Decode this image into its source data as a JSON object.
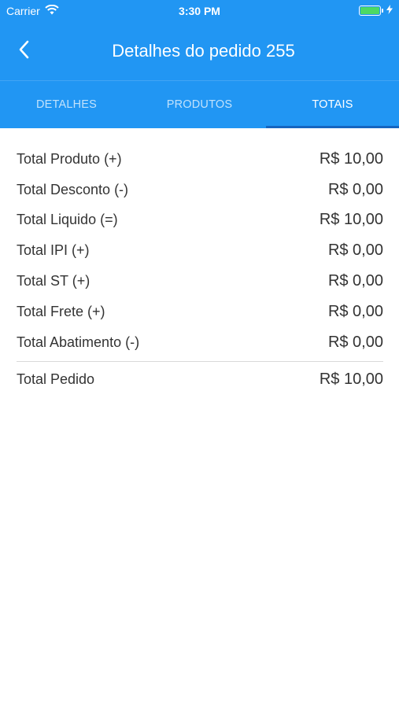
{
  "status": {
    "carrier": "Carrier",
    "time": "3:30 PM"
  },
  "header": {
    "title": "Detalhes do pedido 255"
  },
  "tabs": [
    {
      "label": "DETALHES",
      "active": false
    },
    {
      "label": "PRODUTOS",
      "active": false
    },
    {
      "label": "TOTAIS",
      "active": true
    }
  ],
  "totals": [
    {
      "label": "Total Produto (+)",
      "value": "R$ 10,00"
    },
    {
      "label": "Total Desconto (-)",
      "value": "R$ 0,00"
    },
    {
      "label": "Total Liquido (=)",
      "value": "R$ 10,00"
    },
    {
      "label": "Total IPI (+)",
      "value": "R$ 0,00"
    },
    {
      "label": "Total ST (+)",
      "value": "R$ 0,00"
    },
    {
      "label": "Total Frete (+)",
      "value": "R$ 0,00"
    },
    {
      "label": "Total Abatimento (-)",
      "value": "R$ 0,00"
    }
  ],
  "grand_total": {
    "label": "Total Pedido",
    "value": "R$ 10,00"
  },
  "colors": {
    "primary": "#2196f3",
    "indicator": "#1565c0",
    "battery": "#4cd964"
  },
  "icons": {
    "back": "chevron-left-icon",
    "wifi": "wifi-icon",
    "battery": "battery-icon",
    "charging": "bolt-icon"
  }
}
